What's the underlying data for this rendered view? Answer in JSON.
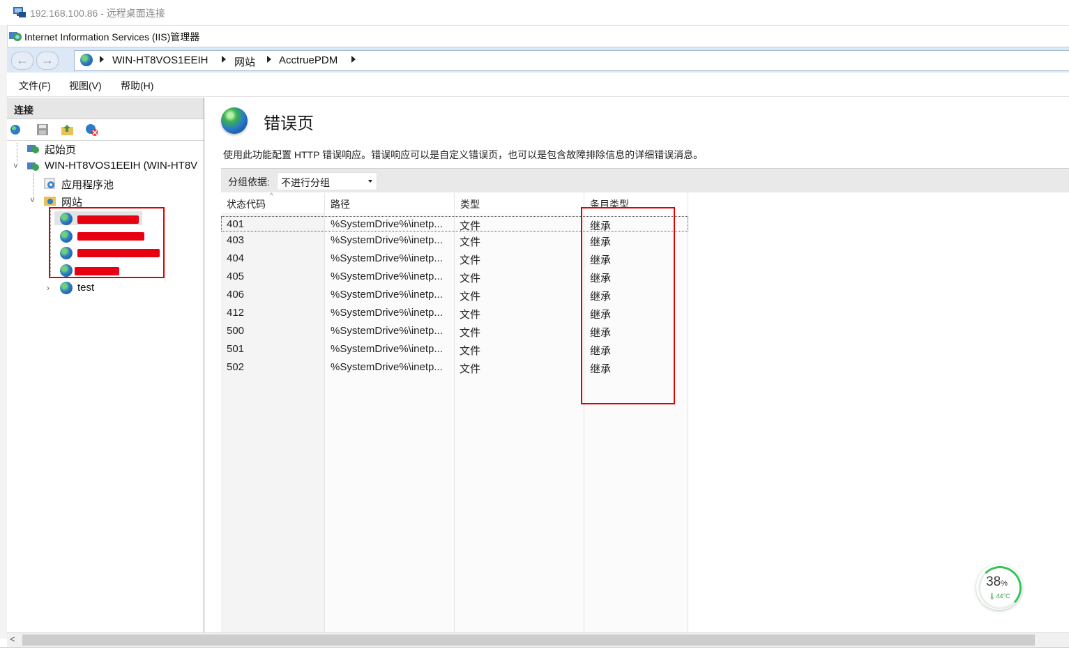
{
  "rdp": {
    "title": "192.168.100.86 - 远程桌面连接"
  },
  "window": {
    "title": "Internet Information Services (IIS)管理器"
  },
  "address": {
    "crumbs": [
      "WIN-HT8VOS1EEIH",
      "网站",
      "AcctruePDM"
    ]
  },
  "menu": {
    "items": [
      "文件(F)",
      "视图(V)",
      "帮助(H)"
    ]
  },
  "connections": {
    "title": "连接",
    "tree": {
      "start_page": "起始页",
      "server": "WIN-HT8VOS1EEIH (WIN-HT8V",
      "app_pools": "应用程序池",
      "sites": "网站",
      "site_test": "test"
    }
  },
  "main": {
    "title": "错误页",
    "description": "使用此功能配置 HTTP 错误响应。错误响应可以是自定义错误页，也可以是包含故障排除信息的详细错误消息。",
    "group_by_label": "分组依据:",
    "group_by_value": "不进行分组",
    "columns": [
      "状态代码",
      "路径",
      "类型",
      "条目类型"
    ],
    "rows": [
      {
        "code": "401",
        "path": "%SystemDrive%\\inetp...",
        "type": "文件",
        "entry": "继承"
      },
      {
        "code": "403",
        "path": "%SystemDrive%\\inetp...",
        "type": "文件",
        "entry": "继承"
      },
      {
        "code": "404",
        "path": "%SystemDrive%\\inetp...",
        "type": "文件",
        "entry": "继承"
      },
      {
        "code": "405",
        "path": "%SystemDrive%\\inetp...",
        "type": "文件",
        "entry": "继承"
      },
      {
        "code": "406",
        "path": "%SystemDrive%\\inetp...",
        "type": "文件",
        "entry": "继承"
      },
      {
        "code": "412",
        "path": "%SystemDrive%\\inetp...",
        "type": "文件",
        "entry": "继承"
      },
      {
        "code": "500",
        "path": "%SystemDrive%\\inetp...",
        "type": "文件",
        "entry": "继承"
      },
      {
        "code": "501",
        "path": "%SystemDrive%\\inetp...",
        "type": "文件",
        "entry": "继承"
      },
      {
        "code": "502",
        "path": "%SystemDrive%\\inetp...",
        "type": "文件",
        "entry": "继承"
      }
    ]
  },
  "cpu_widget": {
    "percent": "38",
    "percent_unit": "%",
    "temperature": "44°C",
    "load_fraction": 0.38
  },
  "colors": {
    "annotation_red": "#e00000",
    "address_bar": "#dce8f6",
    "panel_header": "#e6e6e6"
  }
}
